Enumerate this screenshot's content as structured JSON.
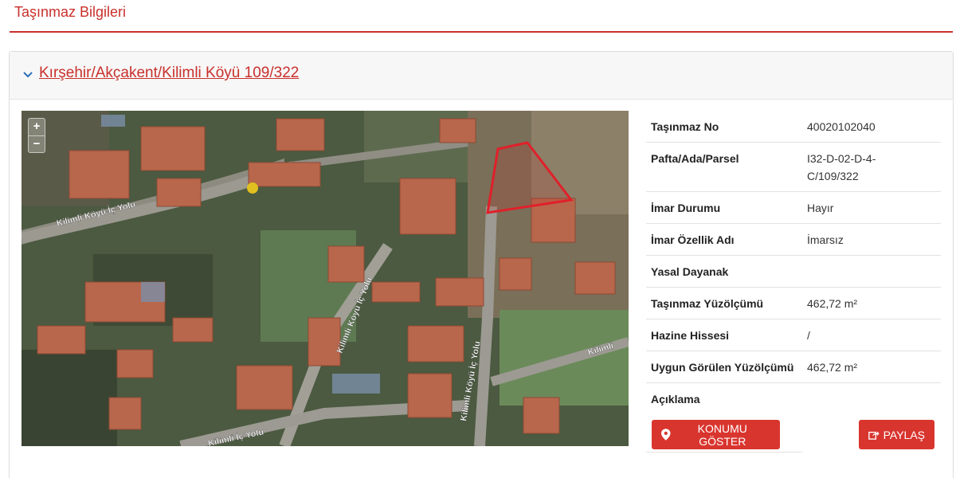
{
  "page": {
    "title": "Taşınmaz Bilgileri"
  },
  "card": {
    "link": "Kırşehir/Akçakent/Kilimli Köyü 109/322"
  },
  "map": {
    "zoom_in": "+",
    "zoom_out": "−",
    "road_labels": [
      "Kilimli Köyü İç Yolu",
      "Kilimli Köyü İç Yolu",
      "Kilimli Köyü İç Yolu",
      "Kilimli",
      "Kilimli İç Yolu"
    ]
  },
  "info": [
    {
      "key": "Taşınmaz No",
      "value": "40020102040"
    },
    {
      "key": "Pafta/Ada/Parsel",
      "value": "I32-D-02-D-4-C/109/322"
    },
    {
      "key": "İmar Durumu",
      "value": "Hayır"
    },
    {
      "key": "İmar Özellik Adı",
      "value": "İmarsız"
    },
    {
      "key": "Yasal Dayanak",
      "value": ""
    },
    {
      "key": "Taşınmaz Yüzölçümü",
      "value": "462,72 m²"
    },
    {
      "key": "Hazine Hissesi",
      "value": "/"
    },
    {
      "key": "Uygun Görülen Yüzölçümü",
      "value": "462,72 m²"
    },
    {
      "key": "Açıklama",
      "value": ""
    }
  ],
  "buttons": {
    "location": "KONUMU GÖSTER",
    "share": "PAYLAŞ"
  },
  "colors": {
    "accent": "#c9302c",
    "button": "#d9352f",
    "parcel": "#e0202a"
  }
}
